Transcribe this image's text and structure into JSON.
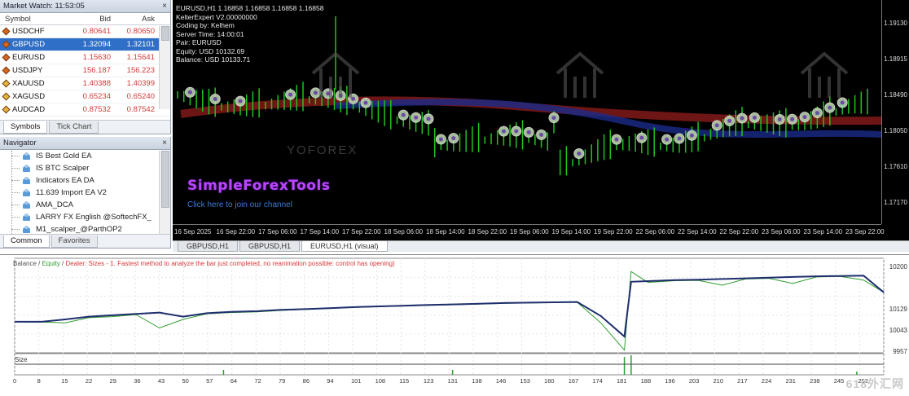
{
  "market_watch": {
    "title": "Market Watch: 11:53:05",
    "columns": [
      "Symbol",
      "Bid",
      "Ask"
    ],
    "rows": [
      {
        "symbol": "USDCHF",
        "bid": "0.80641",
        "ask": "0.80650",
        "selected": false,
        "icon_color": "#d9661f"
      },
      {
        "symbol": "GBPUSD",
        "bid": "1.32094",
        "ask": "1.32101",
        "selected": true,
        "icon_color": "#d9661f"
      },
      {
        "symbol": "EURUSD",
        "bid": "1.15630",
        "ask": "1.15641",
        "selected": false,
        "icon_color": "#d9661f"
      },
      {
        "symbol": "USDJPY",
        "bid": "156.187",
        "ask": "156.223",
        "selected": false,
        "icon_color": "#d9661f"
      },
      {
        "symbol": "XAUUSD",
        "bid": "1.40388",
        "ask": "1.40399",
        "selected": false,
        "icon_color": "#e4b93a"
      },
      {
        "symbol": "XAGUSD",
        "bid": "0.65234",
        "ask": "0.65240",
        "selected": false,
        "icon_color": "#e4b93a"
      },
      {
        "symbol": "AUDCAD",
        "bid": "0.87532",
        "ask": "0.87542",
        "selected": false,
        "icon_color": "#e4b93a"
      }
    ],
    "tabs": [
      "Symbols",
      "Tick Chart"
    ]
  },
  "navigator": {
    "title": "Navigator",
    "items": [
      "IS Best Gold EA",
      "IS BTC Scalper",
      "Indicators EA DA",
      "11.639 Import EA V2",
      "AMA_DCA",
      "LARRY FX English @SoftechFX_",
      "M1_scalper_@ParthOP2"
    ],
    "tabs": [
      "Common",
      "Favorites"
    ]
  },
  "chart": {
    "info_lines": [
      "EURUSD,H1  1.16858 1.16858 1.16858 1.16858",
      "KelterExpert V2.00000000",
      "Coding by: Kelhem",
      "Server Time: 14:00:01",
      "Pair: EURUSD",
      "Equity: USD 10132.69",
      "Balance: USD 10133.71"
    ],
    "brand_text": "SimpleForexTools",
    "join_text": "Click here to join our channel",
    "watermark_text": "YOFOREX",
    "price_labels": [
      "1.19130",
      "1.18915",
      "1.18490",
      "1.18050",
      "1.17610",
      "1.17170"
    ],
    "time_labels": [
      "16 Sep 2025",
      "16 Sep 22:00",
      "17 Sep 06:00",
      "17 Sep 14:00",
      "17 Sep 22:00",
      "18 Sep 06:00",
      "18 Sep 14:00",
      "18 Sep 22:00",
      "19 Sep 06:00",
      "19 Sep 14:00",
      "19 Sep 22:00",
      "22 Sep 06:00",
      "22 Sep 14:00",
      "22 Sep 22:00",
      "23 Sep 06:00",
      "23 Sep 14:00",
      "23 Sep 22:00"
    ]
  },
  "chart_tabs": [
    "GBPUSD,H1",
    "GBPUSD,H1",
    "EURUSD,H1 (visual)"
  ],
  "tester": {
    "legend_balance": "Balance",
    "legend_equity": "Equity",
    "legend_rest": "Dealer: Sizes - 1. Fastest method to analyze the bar just completed, no reanimation possible: control has opening)",
    "y_labels": [
      "10200",
      "10129",
      "10043",
      "9957"
    ],
    "size_label": "Size",
    "x_labels": [
      "0",
      "8",
      "15",
      "22",
      "29",
      "36",
      "43",
      "50",
      "57",
      "64",
      "72",
      "79",
      "86",
      "94",
      "101",
      "108",
      "115",
      "123",
      "131",
      "138",
      "146",
      "153",
      "160",
      "167",
      "174",
      "181",
      "188",
      "196",
      "203",
      "210",
      "217",
      "224",
      "231",
      "238",
      "245",
      "252"
    ],
    "site_watermark": "618外汇网"
  },
  "chart_data": {
    "type": "line",
    "title": "",
    "xlabel": "",
    "ylabel": "",
    "ylim": [
      9957,
      10200
    ],
    "series": [
      {
        "name": "Balance",
        "color": "#1f2e6e",
        "x": [
          0,
          8,
          15,
          22,
          29,
          36,
          43,
          50,
          57,
          64,
          72,
          79,
          86,
          94,
          101,
          108,
          115,
          123,
          131,
          138,
          146,
          153,
          160,
          167,
          174,
          181,
          183,
          188,
          196,
          203,
          210,
          217,
          224,
          231,
          238,
          245,
          252,
          258
        ],
        "values": [
          10043,
          10043,
          10050,
          10058,
          10062,
          10066,
          10070,
          10058,
          10068,
          10072,
          10074,
          10078,
          10080,
          10083,
          10086,
          10088,
          10090,
          10092,
          10094,
          10096,
          10098,
          10099,
          10100,
          10101,
          10060,
          10000,
          10160,
          10162,
          10165,
          10166,
          10168,
          10170,
          10172,
          10174,
          10176,
          10177,
          10178,
          10129
        ]
      },
      {
        "name": "Equity",
        "color": "#2e9d2e",
        "x": [
          0,
          8,
          15,
          22,
          29,
          36,
          43,
          50,
          57,
          64,
          72,
          79,
          86,
          94,
          101,
          108,
          115,
          123,
          131,
          138,
          146,
          153,
          160,
          167,
          174,
          181,
          183,
          188,
          196,
          203,
          210,
          217,
          224,
          231,
          238,
          245,
          252,
          258
        ],
        "values": [
          10043,
          10042,
          10040,
          10055,
          10058,
          10064,
          10025,
          10050,
          10066,
          10070,
          10072,
          10076,
          10079,
          10082,
          10085,
          10087,
          10089,
          10091,
          10093,
          10095,
          10097,
          10098,
          10099,
          10100,
          10040,
          9960,
          10190,
          10158,
          10163,
          10164,
          10150,
          10168,
          10170,
          10155,
          10174,
          10176,
          10165,
          10129
        ]
      }
    ]
  }
}
